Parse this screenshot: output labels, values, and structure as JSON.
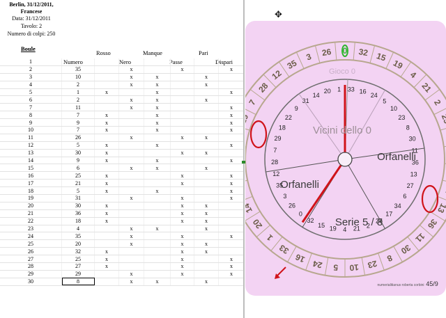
{
  "header": {
    "title": "Berlin, 31/12/2011, Francese",
    "date": "Data: 31/12/2011",
    "table": "Tavolo: 2",
    "spins": "Numero di colpi: 250",
    "section": "Boule"
  },
  "columns": [
    "Numero",
    "Rosso",
    "Nero",
    "Manque",
    "Passe",
    "Pari",
    "Dispari"
  ],
  "rows": [
    {
      "i": "1",
      "n": "",
      "r": "",
      "b": "",
      "m": "",
      "p": "",
      "e": "",
      "o": ""
    },
    {
      "i": "2",
      "n": "35",
      "r": "",
      "b": "x",
      "m": "",
      "p": "x",
      "e": "",
      "o": "x"
    },
    {
      "i": "3",
      "n": "10",
      "r": "",
      "b": "x",
      "m": "x",
      "p": "",
      "e": "x",
      "o": ""
    },
    {
      "i": "4",
      "n": "2",
      "r": "",
      "b": "x",
      "m": "x",
      "p": "",
      "e": "x",
      "o": ""
    },
    {
      "i": "5",
      "n": "1",
      "r": "x",
      "b": "",
      "m": "x",
      "p": "",
      "e": "",
      "o": "x"
    },
    {
      "i": "6",
      "n": "2",
      "r": "",
      "b": "x",
      "m": "x",
      "p": "",
      "e": "x",
      "o": ""
    },
    {
      "i": "7",
      "n": "11",
      "r": "",
      "b": "x",
      "m": "x",
      "p": "",
      "e": "",
      "o": "x"
    },
    {
      "i": "8",
      "n": "7",
      "r": "x",
      "b": "",
      "m": "x",
      "p": "",
      "e": "",
      "o": "x"
    },
    {
      "i": "9",
      "n": "9",
      "r": "x",
      "b": "",
      "m": "x",
      "p": "",
      "e": "",
      "o": "x"
    },
    {
      "i": "10",
      "n": "7",
      "r": "x",
      "b": "",
      "m": "x",
      "p": "",
      "e": "",
      "o": "x"
    },
    {
      "i": "11",
      "n": "26",
      "r": "",
      "b": "x",
      "m": "",
      "p": "x",
      "e": "x",
      "o": ""
    },
    {
      "i": "12",
      "n": "5",
      "r": "x",
      "b": "",
      "m": "x",
      "p": "",
      "e": "",
      "o": "x"
    },
    {
      "i": "13",
      "n": "30",
      "r": "x",
      "b": "",
      "m": "",
      "p": "x",
      "e": "x",
      "o": ""
    },
    {
      "i": "14",
      "n": "9",
      "r": "x",
      "b": "",
      "m": "x",
      "p": "",
      "e": "",
      "o": "x"
    },
    {
      "i": "15",
      "n": "6",
      "r": "",
      "b": "x",
      "m": "x",
      "p": "",
      "e": "x",
      "o": ""
    },
    {
      "i": "16",
      "n": "25",
      "r": "x",
      "b": "",
      "m": "",
      "p": "x",
      "e": "",
      "o": "x"
    },
    {
      "i": "17",
      "n": "21",
      "r": "x",
      "b": "",
      "m": "",
      "p": "x",
      "e": "",
      "o": "x"
    },
    {
      "i": "18",
      "n": "5",
      "r": "x",
      "b": "",
      "m": "x",
      "p": "",
      "e": "",
      "o": "x"
    },
    {
      "i": "19",
      "n": "31",
      "r": "",
      "b": "x",
      "m": "",
      "p": "x",
      "e": "",
      "o": "x"
    },
    {
      "i": "20",
      "n": "30",
      "r": "x",
      "b": "",
      "m": "",
      "p": "x",
      "e": "x",
      "o": ""
    },
    {
      "i": "21",
      "n": "36",
      "r": "x",
      "b": "",
      "m": "",
      "p": "x",
      "e": "x",
      "o": ""
    },
    {
      "i": "22",
      "n": "18",
      "r": "x",
      "b": "",
      "m": "",
      "p": "x",
      "e": "x",
      "o": ""
    },
    {
      "i": "23",
      "n": "4",
      "r": "",
      "b": "x",
      "m": "x",
      "p": "",
      "e": "x",
      "o": ""
    },
    {
      "i": "24",
      "n": "35",
      "r": "",
      "b": "x",
      "m": "",
      "p": "x",
      "e": "",
      "o": "x"
    },
    {
      "i": "25",
      "n": "20",
      "r": "",
      "b": "x",
      "m": "",
      "p": "x",
      "e": "x",
      "o": ""
    },
    {
      "i": "26",
      "n": "32",
      "r": "x",
      "b": "",
      "m": "",
      "p": "x",
      "e": "x",
      "o": ""
    },
    {
      "i": "27",
      "n": "25",
      "r": "x",
      "b": "",
      "m": "",
      "p": "x",
      "e": "",
      "o": "x"
    },
    {
      "i": "28",
      "n": "27",
      "r": "x",
      "b": "",
      "m": "",
      "p": "x",
      "e": "",
      "o": "x"
    },
    {
      "i": "29",
      "n": "29",
      "r": "",
      "b": "x",
      "m": "",
      "p": "x",
      "e": "",
      "o": "x"
    },
    {
      "i": "30",
      "n": "8",
      "r": "",
      "b": "x",
      "m": "x",
      "p": "",
      "e": "x",
      "o": ""
    }
  ],
  "wheel": {
    "outer_numbers": [
      "0",
      "32",
      "15",
      "19",
      "4",
      "21",
      "2",
      "25",
      "17",
      "34",
      "6",
      "27",
      "13",
      "36",
      "11",
      "30",
      "8",
      "23",
      "10",
      "5",
      "24",
      "16",
      "33",
      "1",
      "20",
      "14",
      "31",
      "9",
      "22",
      "18",
      "29",
      "7",
      "28",
      "12",
      "35",
      "3",
      "26"
    ],
    "inner_numbers": [
      "33",
      "16",
      "24",
      "5",
      "10",
      "23",
      "8",
      "30",
      "11",
      "36",
      "13",
      "27",
      "6",
      "34",
      "17",
      "25",
      "2",
      "21",
      "4",
      "19",
      "15",
      "32",
      "0",
      "26",
      "3",
      "35",
      "12",
      "28",
      "7",
      "29",
      "18",
      "22",
      "9",
      "31",
      "14",
      "20",
      "1"
    ],
    "labels": {
      "vicini": "Vicini dello 0",
      "orfanelli_right": "Orfanelli",
      "orfanelli_left": "Orfanelli",
      "serie": "Serie 5 / 8",
      "watermark": "Gioco 0",
      "credit": "numerialitianus roberta corbini",
      "page": "45/9"
    },
    "colors": {
      "background": "#f3d3f3",
      "ring": "#b7a78e",
      "marker": "#d0131a",
      "zero": "#2fb62f"
    }
  }
}
